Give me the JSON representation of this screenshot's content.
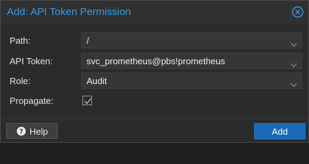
{
  "dialog": {
    "title": "Add: API Token Permission",
    "accent_color": "#3b9ae1",
    "close_icon": "close-circle-icon"
  },
  "form": {
    "path": {
      "label": "Path:",
      "value": "/"
    },
    "api_token": {
      "label": "API Token:",
      "value": "svc_prometheus@pbs!prometheus"
    },
    "role": {
      "label": "Role:",
      "value": "Audit"
    },
    "propagate": {
      "label": "Propagate:",
      "checked": true
    }
  },
  "footer": {
    "help_label": "Help",
    "help_icon": "question-circle-icon",
    "add_label": "Add",
    "add_color": "#1a6bb5"
  }
}
